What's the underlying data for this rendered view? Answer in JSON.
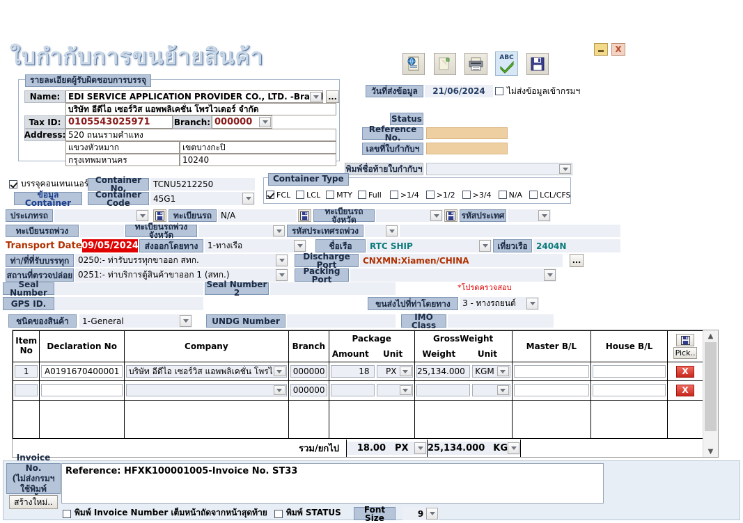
{
  "document": {
    "title": "ใบกำกับการขนย้ายสินค้า"
  },
  "window_controls": {
    "minimize": "_",
    "close": "X"
  },
  "toolbar": {
    "buttons": [
      {
        "name": "export-web-icon",
        "label": ""
      },
      {
        "name": "copy-page-icon",
        "label": ""
      },
      {
        "name": "print-icon",
        "label": ""
      },
      {
        "name": "spellcheck-icon",
        "label": "ABC"
      },
      {
        "name": "save-icon",
        "label": ""
      }
    ]
  },
  "send_date": {
    "label": "วันที่ส่งข้อมูล",
    "value": "21/06/2024",
    "no_send_label": "ไม่ส่งข้อมูลเข้ากรมฯ",
    "no_send_checked": false
  },
  "status_panel": {
    "status_label": "Status",
    "status_value": "",
    "reference_label": "Reference No.",
    "reference_value": "",
    "invoice_no_label": "เลขที่ใบกำกับฯ",
    "invoice_no_value": "",
    "print_name_label": "พิมพ์ชื่อท้ายใบกำกับฯ",
    "print_name_value": ""
  },
  "packer": {
    "group_title": "รายละเอียดผู้รับผิดชอบการบรรจุ",
    "name_label": "Name:",
    "name_value": "EDI SERVICE APPLICATION PROVIDER CO., LTD. -Branch (",
    "name_thai": "บริษัท อีดีไอ เซอร์วิส แอพพลิเคชั่น โพรไวเดอร์ จำกัด",
    "browse_label": "...",
    "tax_id_label": "Tax ID:",
    "tax_id_value": "0105543025971",
    "branch_label": "Branch:",
    "branch_value": "000000",
    "address_label": "Address:",
    "address_line1": "520 ถนนรามคำแหง",
    "address_sub_district": "แขวงหัวหมาก",
    "address_district": "เขตบางกะปิ",
    "address_province": "กรุงเทพมหานคร",
    "address_postcode": "10240"
  },
  "container": {
    "pack_container_label": "บรรจุคอนเทนเนอร์",
    "pack_container_checked": true,
    "container_info_button": "ข้อมูล Container",
    "container_no_label": "Container No.",
    "container_no_value": "TCNU5212250",
    "container_code_label": "Container Code",
    "container_code_value": "45G1",
    "type_group_title": "Container Type",
    "types": [
      {
        "label": "FCL",
        "checked": true
      },
      {
        "label": "LCL",
        "checked": false
      },
      {
        "label": "MTY",
        "checked": false
      },
      {
        "label": "Full",
        "checked": false
      },
      {
        "label": ">1/4",
        "checked": false
      },
      {
        "label": ">1/2",
        "checked": false
      },
      {
        "label": ">3/4",
        "checked": false
      },
      {
        "label": "N/A",
        "checked": false
      },
      {
        "label": "LCL/CFS",
        "checked": false
      }
    ]
  },
  "vehicle": {
    "type_label": "ประเภทรถ",
    "type_value": "",
    "plate_label": "ทะเบียนรถ",
    "plate_value": "N/A",
    "plate_province_label": "ทะเบียนรถจังหวัด",
    "plate_province_value": "",
    "country_code_label": "รหัสประเทศ",
    "country_code_value": "",
    "trailer_plate_label": "ทะเบียนรถพ่วง",
    "trailer_plate_value": "",
    "trailer_province_label": "ทะเบียนรถพ่วงจังหวัด",
    "trailer_province_value": "",
    "trailer_country_label": "รหัสประเทศรถพ่วง",
    "trailer_country_value": ""
  },
  "transport": {
    "date_label": "Transport Date",
    "date_value": "09/05/2024",
    "export_by_label": "ส่งออกโดยทาง",
    "export_by_value": "1-ทางเรือ",
    "vessel_label": "ชื่อเรือ",
    "vessel_value": "RTC SHIP",
    "voyage_label": "เที่ยวเรือ",
    "voyage_value": "2404N",
    "loading_port_label": "ท่า/ที่ที่รับบรรทุก",
    "loading_port_value": "0250:- ท่ารับบรรทุกขาออก สทก.",
    "discharge_port_label": "Discharge Port",
    "discharge_port_value": "CNXMN:Xiamen/CHINA",
    "discharge_browse": "...",
    "release_place_label": "สถานที่ตรวจปล่อย",
    "release_place_value": "0251:- ท่าบริการตู้สินค้าขาออก 1 (สทก.)",
    "packing_port_label": "Packing Port",
    "packing_port_value": "",
    "seal_label": "Seal Number",
    "seal_value": "",
    "seal2_label": "Seal Number 2",
    "seal2_value": "",
    "gps_label": "GPS ID.",
    "gps_value": "",
    "please_verify": "*โปรดครวจสอบ",
    "transport_to_port_label": "ขนส่งไปที่ท่าโดยทาง",
    "transport_to_port_value": "3 - ทางรถยนต์",
    "goods_type_label": "ชนิดของสินค้า",
    "goods_type_value": "1-General",
    "undg_label": "UNDG Number",
    "undg_value": "",
    "imo_label": "IMO Class",
    "imo_value": ""
  },
  "items_table": {
    "headers": {
      "item_no": "Item No",
      "declaration_no": "Declaration No",
      "company": "Company",
      "branch": "Branch",
      "package": "Package",
      "package_amount": "Amount",
      "package_unit": "Unit",
      "gross_weight": "GrossWeight",
      "weight": "Weight",
      "weight_unit": "Unit",
      "master_bl": "Master B/L",
      "house_bl": "House B/L"
    },
    "action_save": "",
    "action_pick": "Pick..",
    "action_delete": "X",
    "rows": [
      {
        "item_no": "1",
        "declaration_no": "A0191670400001",
        "company": "บริษัท อีดีไอ เซอร์วิส แอพพลิเคชั่น โพรไวเด",
        "branch": "000000",
        "amount": "18",
        "unit": "PX",
        "weight": "25,134.000",
        "weight_unit": "KGM",
        "master_bl": "",
        "house_bl": ""
      },
      {
        "item_no": "",
        "declaration_no": "",
        "company": "",
        "branch": "000000",
        "amount": "",
        "unit": "",
        "weight": "",
        "weight_unit": "",
        "master_bl": "",
        "house_bl": ""
      }
    ],
    "total_label": "รวม/ยกไป",
    "total_amount": "18.00",
    "total_unit": "PX",
    "total_weight": "25,134.000",
    "total_weight_unit": "KGM"
  },
  "invoice_footer": {
    "invoice_label_line1": "Invoice No.",
    "invoice_label_line2": "(ไม่ส่งกรมฯ",
    "invoice_label_line3": "ใช้พิมพ์เท่านั้น)",
    "new_button": "สร้างใหม่..",
    "memo_text": "Reference: HFXK100001005-Invoice No. ST33",
    "print_invoice_label": "พิมพ์ Invoice Number เต็มหน้าถัดจากหน้าสุดท้าย",
    "print_invoice_checked": false,
    "print_status_label": "พิมพ์ STATUS",
    "print_status_checked": false,
    "font_size_label": "Font Size",
    "font_size_value": "9"
  },
  "colors": {
    "label_blue": "#b5c4d8",
    "field_blue": "#eceff5",
    "accent_red": "#cc0000",
    "tan_field": "#eecfa1",
    "teal_text": "#0a7a7a"
  }
}
